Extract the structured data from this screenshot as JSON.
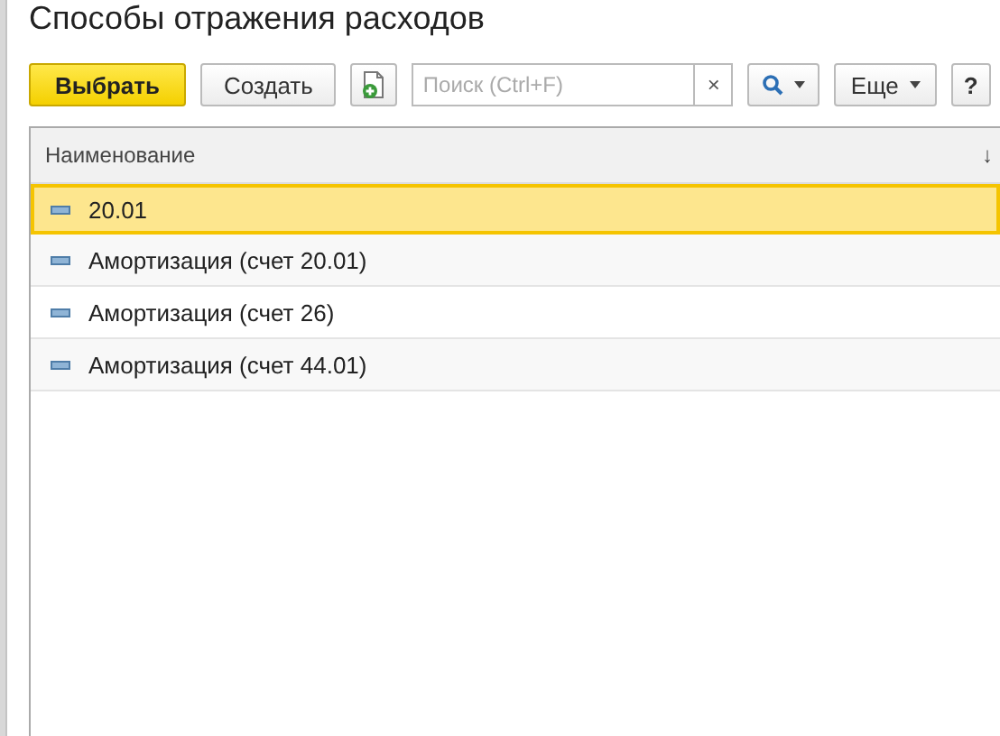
{
  "title": "Способы отражения расходов",
  "toolbar": {
    "select_button": "Выбрать",
    "create_button": "Создать",
    "search": {
      "placeholder": "Поиск (Ctrl+F)",
      "clear": "×"
    },
    "more_button": "Еще",
    "help_button": "?"
  },
  "table": {
    "columns": [
      {
        "label": "Наименование",
        "sort": "↓"
      }
    ],
    "rows": [
      {
        "name": "20.01",
        "selected": true
      },
      {
        "name": "Амортизация (счет 20.01)",
        "selected": false
      },
      {
        "name": "Амортизация (счет 26)",
        "selected": false
      },
      {
        "name": "Амортизация (счет 44.01)",
        "selected": false
      }
    ]
  }
}
